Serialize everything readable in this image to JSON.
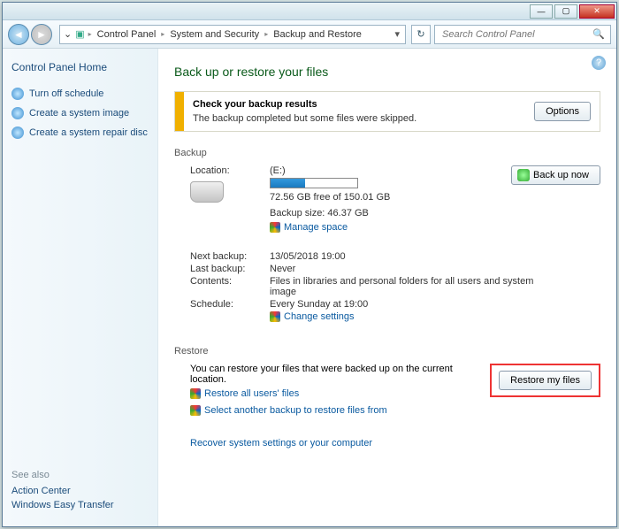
{
  "titlebar": {
    "min": "—",
    "max": "▢",
    "close": "✕"
  },
  "nav": {
    "crumbs": [
      "Control Panel",
      "System and Security",
      "Backup and Restore"
    ],
    "search_placeholder": "Search Control Panel"
  },
  "sidebar": {
    "home": "Control Panel Home",
    "links": [
      "Turn off schedule",
      "Create a system image",
      "Create a system repair disc"
    ],
    "seealso_h": "See also",
    "seealso": [
      "Action Center",
      "Windows Easy Transfer"
    ]
  },
  "page": {
    "title": "Back up or restore your files",
    "help": "?"
  },
  "alert": {
    "title": "Check your backup results",
    "msg": "The backup completed but some files were skipped.",
    "button": "Options"
  },
  "backup": {
    "heading": "Backup",
    "backup_now": "Back up now",
    "location_lbl": "Location:",
    "location_val": "(E:)",
    "free_text": "72.56 GB free of 150.01 GB",
    "size_text": "Backup size: 46.37 GB",
    "manage_space": "Manage space",
    "progress_pct": 40,
    "next_lbl": "Next backup:",
    "next_val": "13/05/2018 19:00",
    "last_lbl": "Last backup:",
    "last_val": "Never",
    "contents_lbl": "Contents:",
    "contents_val": "Files in libraries and personal folders for all users and system image",
    "schedule_lbl": "Schedule:",
    "schedule_val": "Every Sunday at 19:00",
    "change_settings": "Change settings"
  },
  "restore": {
    "heading": "Restore",
    "msg": "You can restore your files that were backed up on the current location.",
    "button": "Restore my files",
    "restore_all": "Restore all users' files",
    "select_another": "Select another backup to restore files from",
    "recover": "Recover system settings or your computer"
  }
}
